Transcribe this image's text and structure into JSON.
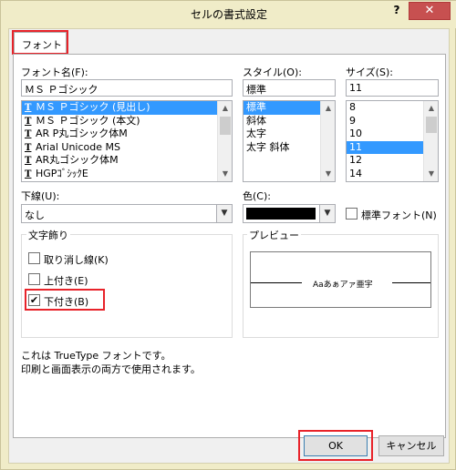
{
  "window": {
    "title": "セルの書式設定",
    "help_label": "?",
    "close_label": "✕"
  },
  "tabs": [
    {
      "label": "フォント"
    }
  ],
  "font": {
    "label": "フォント名(F):",
    "value": "ＭＳ Ｐゴシック",
    "items": [
      {
        "icon": "truetype-icon",
        "label": "ＭＳ Ｐゴシック (見出し)",
        "selected": true
      },
      {
        "icon": "truetype-icon",
        "label": "ＭＳ Ｐゴシック (本文)",
        "selected": false
      },
      {
        "icon": "truetype-icon",
        "label": "AR P丸ゴシック体M",
        "selected": false
      },
      {
        "icon": "truetype-icon",
        "label": "Arial Unicode MS",
        "selected": false
      },
      {
        "icon": "truetype-icon",
        "label": "AR丸ゴシック体M",
        "selected": false
      },
      {
        "icon": "truetype-icon",
        "label": "HGPｺﾞｼｯｸE",
        "selected": false
      }
    ]
  },
  "style": {
    "label": "スタイル(O):",
    "value": "標準",
    "items": [
      {
        "label": "標準",
        "selected": true
      },
      {
        "label": "斜体",
        "selected": false
      },
      {
        "label": "太字",
        "selected": false
      },
      {
        "label": "太字 斜体",
        "selected": false
      }
    ]
  },
  "size": {
    "label": "サイズ(S):",
    "value": "11",
    "items": [
      {
        "label": "8",
        "selected": false
      },
      {
        "label": "9",
        "selected": false
      },
      {
        "label": "10",
        "selected": false
      },
      {
        "label": "11",
        "selected": true
      },
      {
        "label": "12",
        "selected": false
      },
      {
        "label": "14",
        "selected": false
      }
    ]
  },
  "underline": {
    "label": "下線(U):",
    "value": "なし"
  },
  "color": {
    "label": "色(C):",
    "value_hex": "#000000"
  },
  "normal_font": {
    "label": "標準フォント(N)",
    "checked": false
  },
  "effects": {
    "title": "文字飾り",
    "strikethrough": {
      "label": "取り消し線(K)",
      "checked": false
    },
    "superscript": {
      "label": "上付き(E)",
      "checked": false
    },
    "subscript": {
      "label": "下付き(B)",
      "checked": true
    }
  },
  "preview": {
    "title": "プレビュー",
    "sample": "Aaあぁアァ亜宇"
  },
  "info": {
    "line1": "これは TrueType フォントです。",
    "line2": "印刷と画面表示の両方で使用されます。"
  },
  "buttons": {
    "ok": "OK",
    "cancel": "キャンセル"
  },
  "colors": {
    "highlight": "#e8232a",
    "selection": "#3399ff",
    "close": "#c75050"
  }
}
